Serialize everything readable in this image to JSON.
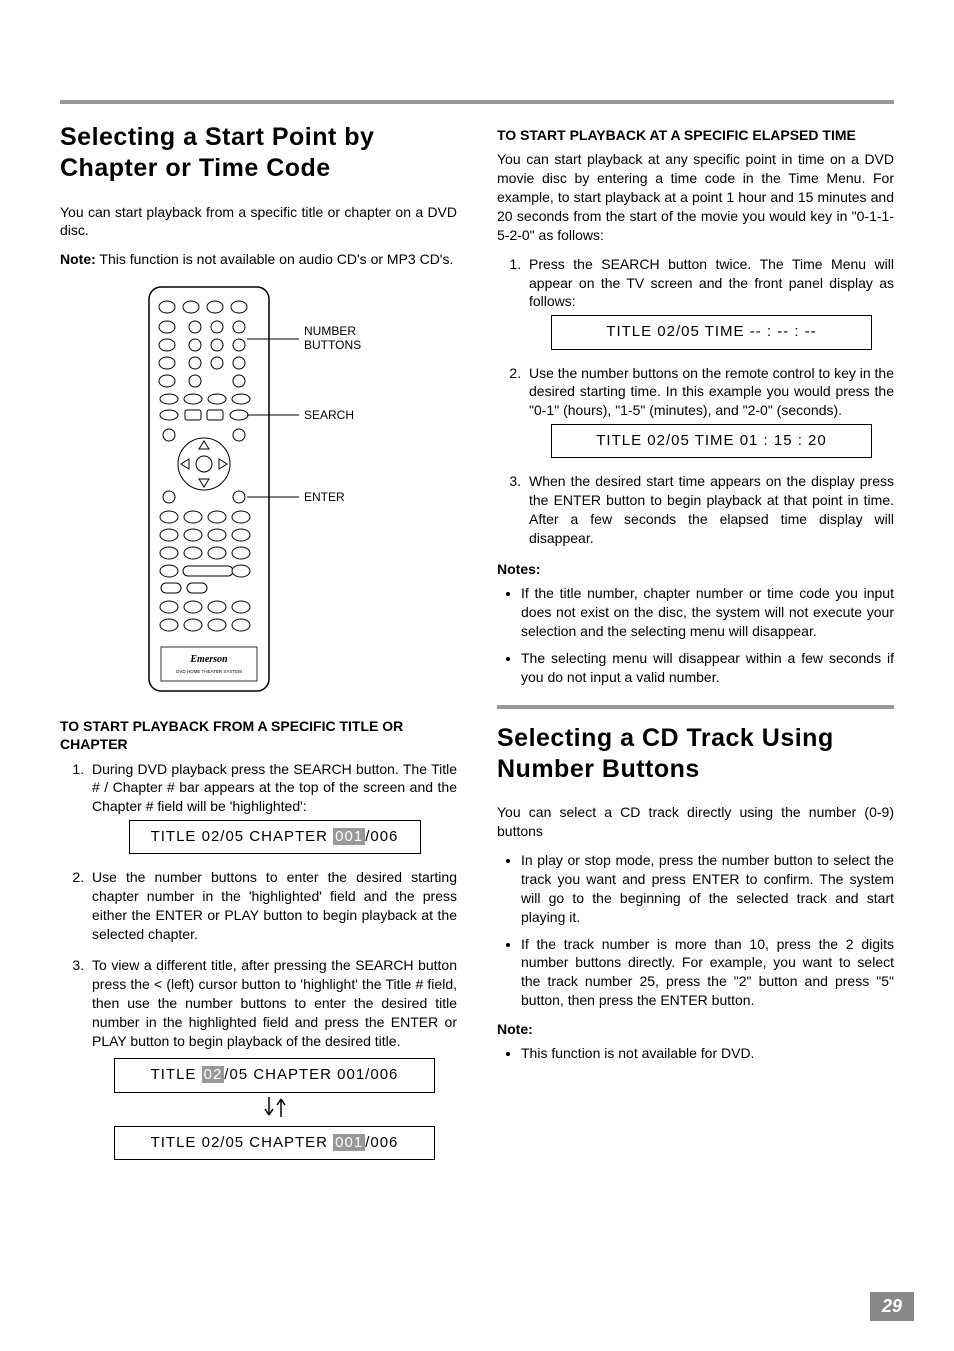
{
  "page_number": "29",
  "left": {
    "heading_line1": "Selecting a Start Point by",
    "heading_line2": "Chapter or Time Code",
    "intro": "You can start playback from a specific title or chapter on a DVD disc.",
    "note_label": "Note:",
    "note_text": "This function is not available on audio CD's or MP3 CD's.",
    "callouts": {
      "number_buttons": "NUMBER BUTTONS",
      "search": "SEARCH",
      "enter": "ENTER"
    },
    "remote_brand": "Emerson",
    "remote_sub": "DVD HOME THEATER SYSTEM",
    "subhead1": "TO START PLAYBACK FROM A SPECIFIC TITLE OR CHAPTER",
    "step1": "During DVD playback press the SEARCH button. The Title # / Chapter # bar appears at the top of the screen and the Chapter # field will be 'highlighted':",
    "display1_pre": "TITLE  02/05  CHAPTER  ",
    "display1_hl": "001",
    "display1_post": "/006",
    "step2": "Use the number buttons to enter the desired starting chapter number in the 'highlighted' field and the press either the ENTER or PLAY button to begin playback at the selected chapter.",
    "step3": "To view a different title, after pressing the SEARCH button press the < (left) cursor button to 'highlight' the Title # field, then use the number buttons to enter the desired title number in the highlighted field and press the ENTER or PLAY button to begin playback of the desired title.",
    "display2a_pre": "TITLE  ",
    "display2a_hl": "02",
    "display2a_post": "/05  CHAPTER  001/006",
    "display2b_pre": "TITLE  02/05  CHAPTER  ",
    "display2b_hl": "001",
    "display2b_post": "/006"
  },
  "right": {
    "subhead_time": "TO START PLAYBACK AT A SPECIFIC ELAPSED TIME",
    "time_intro": "You can start playback at any specific point in time on a DVD movie disc by entering a time code in the Time Menu. For example, to start playback at a point 1 hour and 15 minutes and 20 seconds from the start of the movie you would key in \"0-1-1-5-2-0\" as follows:",
    "time_step1": "Press the SEARCH button twice. The Time Menu will appear on the TV screen and the front panel display as follows:",
    "time_display1": "TITLE  02/05  TIME  -- : -- : --",
    "time_step2": "Use the number buttons on the remote control to key in the desired starting time. In this example you would press the \"0-1\" (hours), \"1-5\" (minutes), and \"2-0\" (seconds).",
    "time_display2": "TITLE  02/05  TIME  01 : 15 : 20",
    "time_step3": "When the desired start time appears on the display press the ENTER button to begin playback at that point in time. After a few seconds the elapsed time display will disappear.",
    "notes_label": "Notes:",
    "notes_bullet1": "If the title number, chapter number or time code you input does not exist on the disc, the system will not execute your selection and the selecting menu will disappear.",
    "notes_bullet2": "The selecting menu will disappear within a few seconds if you do not input a valid number.",
    "heading2_line1": "Selecting a CD Track Using",
    "heading2_line2": "Number Buttons",
    "cd_intro": "You can select a CD track directly using the number (0-9) buttons",
    "cd_bullet1": "In play or stop mode, press the number button to select the track you want and press ENTER to confirm. The system will go to the beginning of the selected track and start playing it.",
    "cd_bullet2": "If the track number is more than 10, press the 2 digits number buttons directly. For example, you want to select the track number 25, press the \"2\" button and press \"5\" button, then press the ENTER button.",
    "cd_note_label": "Note:",
    "cd_note_bullet": "This function is not available for DVD."
  }
}
